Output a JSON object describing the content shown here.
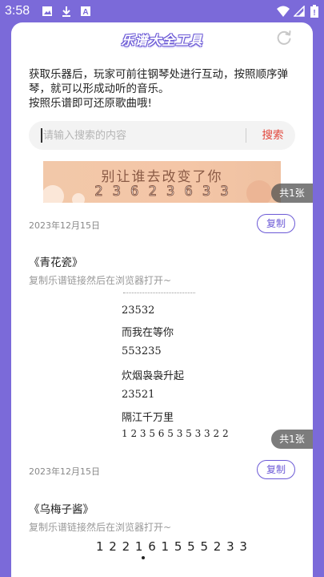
{
  "status_bar": {
    "time": "3:58",
    "left_icons": [
      "image-icon",
      "download-icon",
      "text-a-icon"
    ],
    "right_icons": [
      "wifi-icon",
      "signal-icon",
      "battery-icon"
    ]
  },
  "header": {
    "title": "乐谱大全工具",
    "refresh_icon": "refresh-icon"
  },
  "intro": {
    "line1": "获取乐器后，玩家可前往钢琴处进行互动，按照顺序弹琴，就可以形成动听的音乐。",
    "line2": "按照乐谱即可还原歌曲哦!"
  },
  "search": {
    "placeholder": "请输入搜索的内容",
    "value": "",
    "button": "搜索"
  },
  "posts": [
    {
      "banner_text": "别让谁去改变了你",
      "banner_numbers": "2 3 6 2 3 6 3 3",
      "page_count": "共1张",
      "date": "2023年12月15日",
      "copy_label": "复制"
    },
    {
      "title": "《青花瓷》",
      "hint": "复制乐谱链接然后在浏览器打开~",
      "score_lines": [
        "23532",
        "而我在等你",
        "553235",
        "炊烟袅袅升起",
        "23521",
        "隔江千万里",
        "1 2 3 5 6 5 3 5 3 3 2 2"
      ],
      "page_count": "共1张",
      "date": "2023年12月15日",
      "copy_label": "复制"
    },
    {
      "title": "《乌梅子酱》",
      "hint": "复制乐谱链接然后在浏览器打开~",
      "score_line": "1 2 2 1 6 1 5 5 5 2 3 3"
    }
  ]
}
